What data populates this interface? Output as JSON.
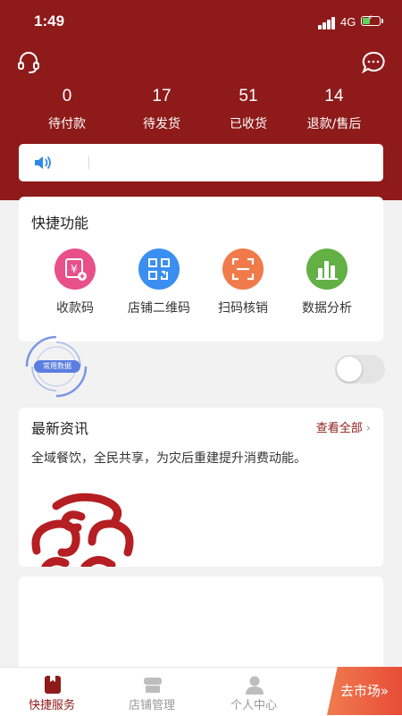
{
  "status_bar": {
    "time": "1:49",
    "network": "4G"
  },
  "stats": [
    {
      "value": "0",
      "label": "待付款"
    },
    {
      "value": "17",
      "label": "待发货"
    },
    {
      "value": "51",
      "label": "已收货"
    },
    {
      "value": "14",
      "label": "退款/售后"
    }
  ],
  "quick": {
    "title": "快捷功能",
    "items": [
      {
        "label": "收款码",
        "icon": "payment-code-icon",
        "color": "#e8508a"
      },
      {
        "label": "店铺二维码",
        "icon": "qr-code-icon",
        "color": "#3b8ff0"
      },
      {
        "label": "扫码核销",
        "icon": "scan-icon",
        "color": "#f07a4a"
      },
      {
        "label": "数据分析",
        "icon": "bar-chart-icon",
        "color": "#63b045"
      }
    ]
  },
  "floater": {
    "label": "常用数据"
  },
  "news": {
    "title": "最新资讯",
    "more": "查看全部",
    "text": "全域餐饮，全民共享，为灾后重建提升消费动能。"
  },
  "tabbar": {
    "tabs": [
      {
        "label": "快捷服务",
        "active": true
      },
      {
        "label": "店铺管理",
        "active": false
      },
      {
        "label": "个人中心",
        "active": false
      }
    ],
    "market": "去市场»"
  },
  "colors": {
    "brand": "#8f1a1a",
    "inactive": "#999999"
  }
}
